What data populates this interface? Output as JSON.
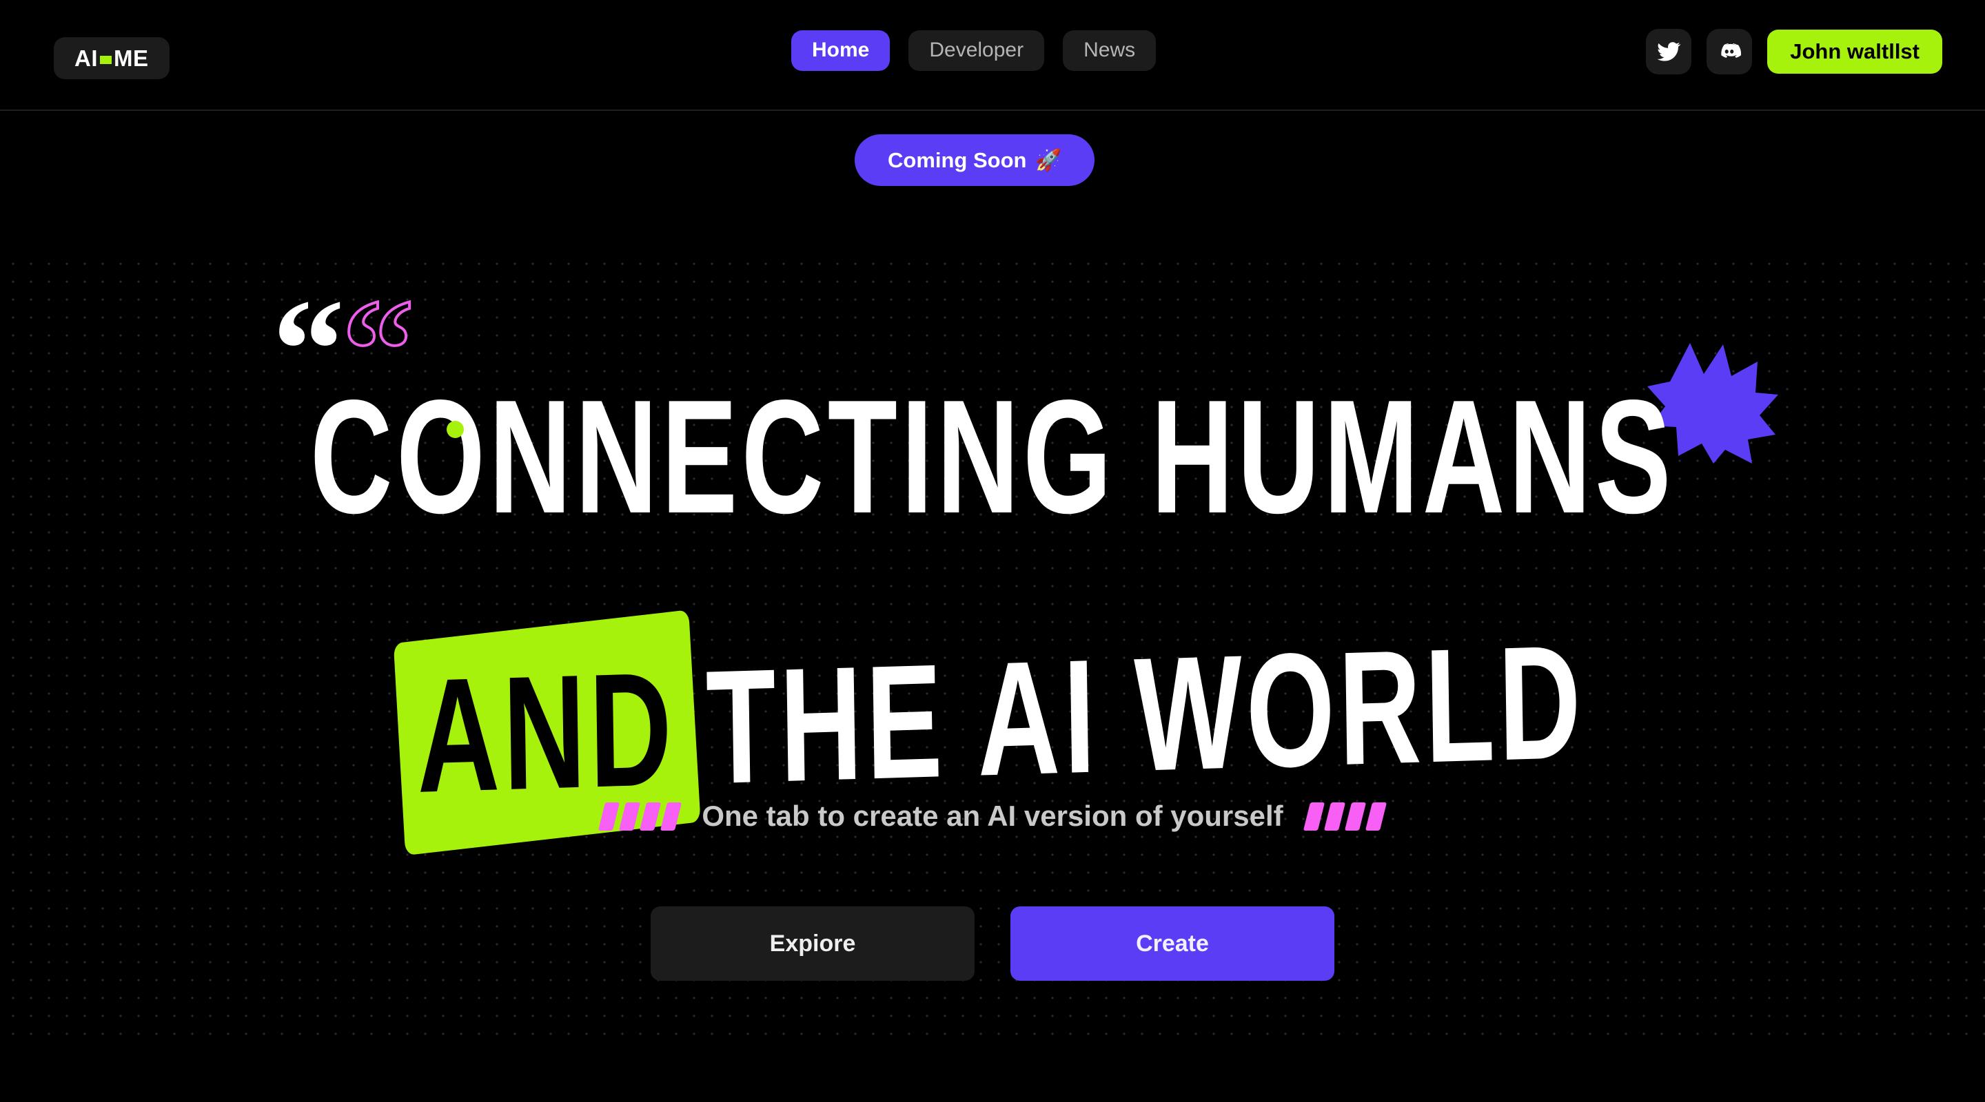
{
  "header": {
    "logo": {
      "prefix": "AI",
      "suffix": "ME",
      "separator_icon": "green-dash-icon",
      "accent_color": "#A6F20C"
    },
    "nav": [
      {
        "label": "Home",
        "active": true
      },
      {
        "label": "Developer",
        "active": false
      },
      {
        "label": "News",
        "active": false
      }
    ],
    "social": [
      {
        "icon": "twitter-icon",
        "name": "twitter"
      },
      {
        "icon": "discord-icon",
        "name": "discord"
      }
    ],
    "cta": {
      "label": "John waltllst",
      "background": "#A6F20C",
      "color": "#000000"
    }
  },
  "hero": {
    "badge": {
      "label": "Coming Soon",
      "emoji": "🚀",
      "background": "#5B3DF5"
    },
    "quote_marks": {
      "solid": "“",
      "outline": "“",
      "solid_color": "#FFFFFF",
      "outline_color": "#ED5FEA"
    },
    "headline": {
      "line1": "CONNECTING HUMANS",
      "line2_highlight": "AND",
      "line2_rest": "THE AI WORLD",
      "highlight_color": "#A6F20C",
      "text_color": "#FFFFFF"
    },
    "decorations": {
      "green_dot_color": "#A6F20C",
      "burst_color": "#5B3DF5",
      "slash_color": "#F75FF5",
      "slash_count_left": 4,
      "slash_count_right": 4,
      "dot_grid_color": "#2B2B2B"
    },
    "tagline": "One tab to create an AI version of yourself",
    "buttons": [
      {
        "label": "Expiore",
        "variant": "secondary",
        "background": "#1c1c1c"
      },
      {
        "label": "Create",
        "variant": "primary",
        "background": "#5B3DF5"
      }
    ]
  }
}
